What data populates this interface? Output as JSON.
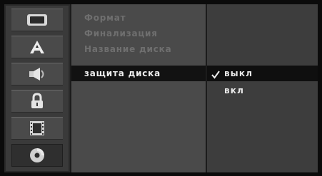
{
  "menu": {
    "icons": [
      {
        "name": "tv-icon"
      },
      {
        "name": "language-icon"
      },
      {
        "name": "audio-icon"
      },
      {
        "name": "lock-icon"
      },
      {
        "name": "film-icon"
      },
      {
        "name": "disc-icon"
      }
    ],
    "items": [
      {
        "label": "Формат"
      },
      {
        "label": "Финализация"
      },
      {
        "label": "Название диска"
      },
      {
        "label": "защита диска"
      }
    ],
    "options": [
      {
        "label": "выкл",
        "checked": true
      },
      {
        "label": "вкл",
        "checked": false
      }
    ]
  }
}
